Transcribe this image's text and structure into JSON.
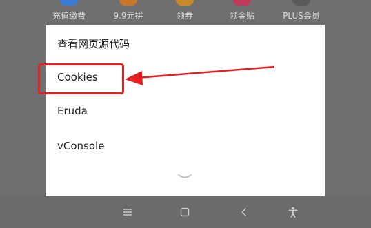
{
  "top_bar": {
    "items": [
      {
        "label": "充值缴费",
        "icon": "recharge-icon",
        "color": "#3a7bd5"
      },
      {
        "label": "9.9元拼",
        "icon": "group-buy-icon",
        "color": "#c8762a"
      },
      {
        "label": "领券",
        "icon": "coupon-icon",
        "color": "#c98a2a"
      },
      {
        "label": "领金贴",
        "icon": "gold-subsidy-icon",
        "color": "#c23a5a"
      },
      {
        "label": "PLUS会员",
        "icon": "plus-member-icon",
        "color": "#5a5a5a"
      }
    ]
  },
  "menu": {
    "items": [
      {
        "label": "查看网页源代码"
      },
      {
        "label": "Cookies"
      },
      {
        "label": "Eruda"
      },
      {
        "label": "vConsole"
      }
    ],
    "collapse_icon": "chevron-down-icon"
  },
  "annotation": {
    "color": "#e62020",
    "target": "Cookies"
  },
  "nav_bar": {
    "icons": [
      "menu-icon",
      "home-square-icon",
      "back-icon",
      "accessibility-icon"
    ]
  }
}
